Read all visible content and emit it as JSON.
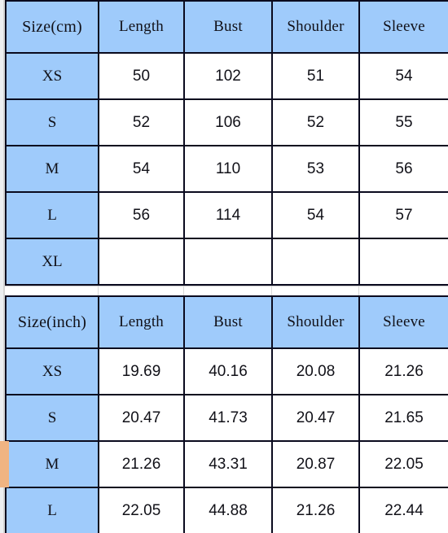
{
  "colors": {
    "header_blue": "#9FCBFB",
    "cell_white": "#FFFFFF",
    "border": "#0A0A1E",
    "marker_orange": "#F0B482",
    "gutter_gray": "#D4D4D4"
  },
  "tables": [
    {
      "id": "cm-table",
      "unit": "cm",
      "columns": [
        "Size(cm)",
        "Length",
        "Bust",
        "Shoulder",
        "Sleeve"
      ],
      "rows": [
        {
          "size": "XS",
          "values": [
            "50",
            "102",
            "51",
            "54"
          ]
        },
        {
          "size": "S",
          "values": [
            "52",
            "106",
            "52",
            "55"
          ]
        },
        {
          "size": "M",
          "values": [
            "54",
            "110",
            "53",
            "56"
          ]
        },
        {
          "size": "L",
          "values": [
            "56",
            "114",
            "54",
            "57"
          ]
        },
        {
          "size": "XL",
          "values": [
            "",
            "",
            "",
            ""
          ]
        }
      ]
    },
    {
      "id": "inch-table",
      "unit": "inch",
      "columns": [
        "Size(inch)",
        "Length",
        "Bust",
        "Shoulder",
        "Sleeve"
      ],
      "rows": [
        {
          "size": "XS",
          "values": [
            "19.69",
            "40.16",
            "20.08",
            "21.26"
          ]
        },
        {
          "size": "S",
          "values": [
            "20.47",
            "41.73",
            "20.47",
            "21.65"
          ]
        },
        {
          "size": "M",
          "values": [
            "21.26",
            "43.31",
            "20.87",
            "22.05"
          ]
        },
        {
          "size": "L",
          "values": [
            "22.05",
            "44.88",
            "21.26",
            "22.44"
          ]
        }
      ]
    }
  ]
}
